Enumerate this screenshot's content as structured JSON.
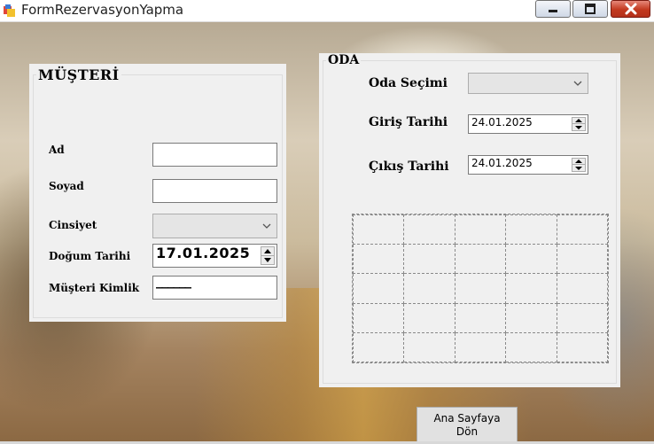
{
  "window": {
    "title": "FormRezervasyonYapma"
  },
  "musteri": {
    "title": "MÜŞTERİ",
    "ad_label": "Ad",
    "ad_value": "",
    "soyad_label": "Soyad",
    "soyad_value": "",
    "cinsiyet_label": "Cinsiyet",
    "cinsiyet_value": "",
    "dogum_label": "Doğum Tarihi",
    "dogum_value": "17.01.2025",
    "kimlik_label": "Müşteri Kimlik",
    "kimlik_value": "______"
  },
  "oda": {
    "title": "ODA",
    "oda_secimi_label": "Oda Seçimi",
    "oda_secimi_value": "",
    "giris_label": "Giriş Tarihi",
    "giris_value": "24.01.2025",
    "cikis_label": "Çıkış Tarihi",
    "cikis_value": "24.01.2025",
    "grid_rows": 5,
    "grid_cols": 5
  },
  "button": {
    "back_label": "Ana Sayfaya Dön"
  },
  "icons": {
    "app": "app-icon",
    "minimize": "minimize-icon",
    "maximize": "maximize-icon",
    "close": "close-icon",
    "dropdown": "chevron-down-icon",
    "spin_up": "spin-up-icon",
    "spin_down": "spin-down-icon"
  },
  "colors": {
    "close_button": "#c2391f",
    "form_background": "#f0f0f0"
  }
}
